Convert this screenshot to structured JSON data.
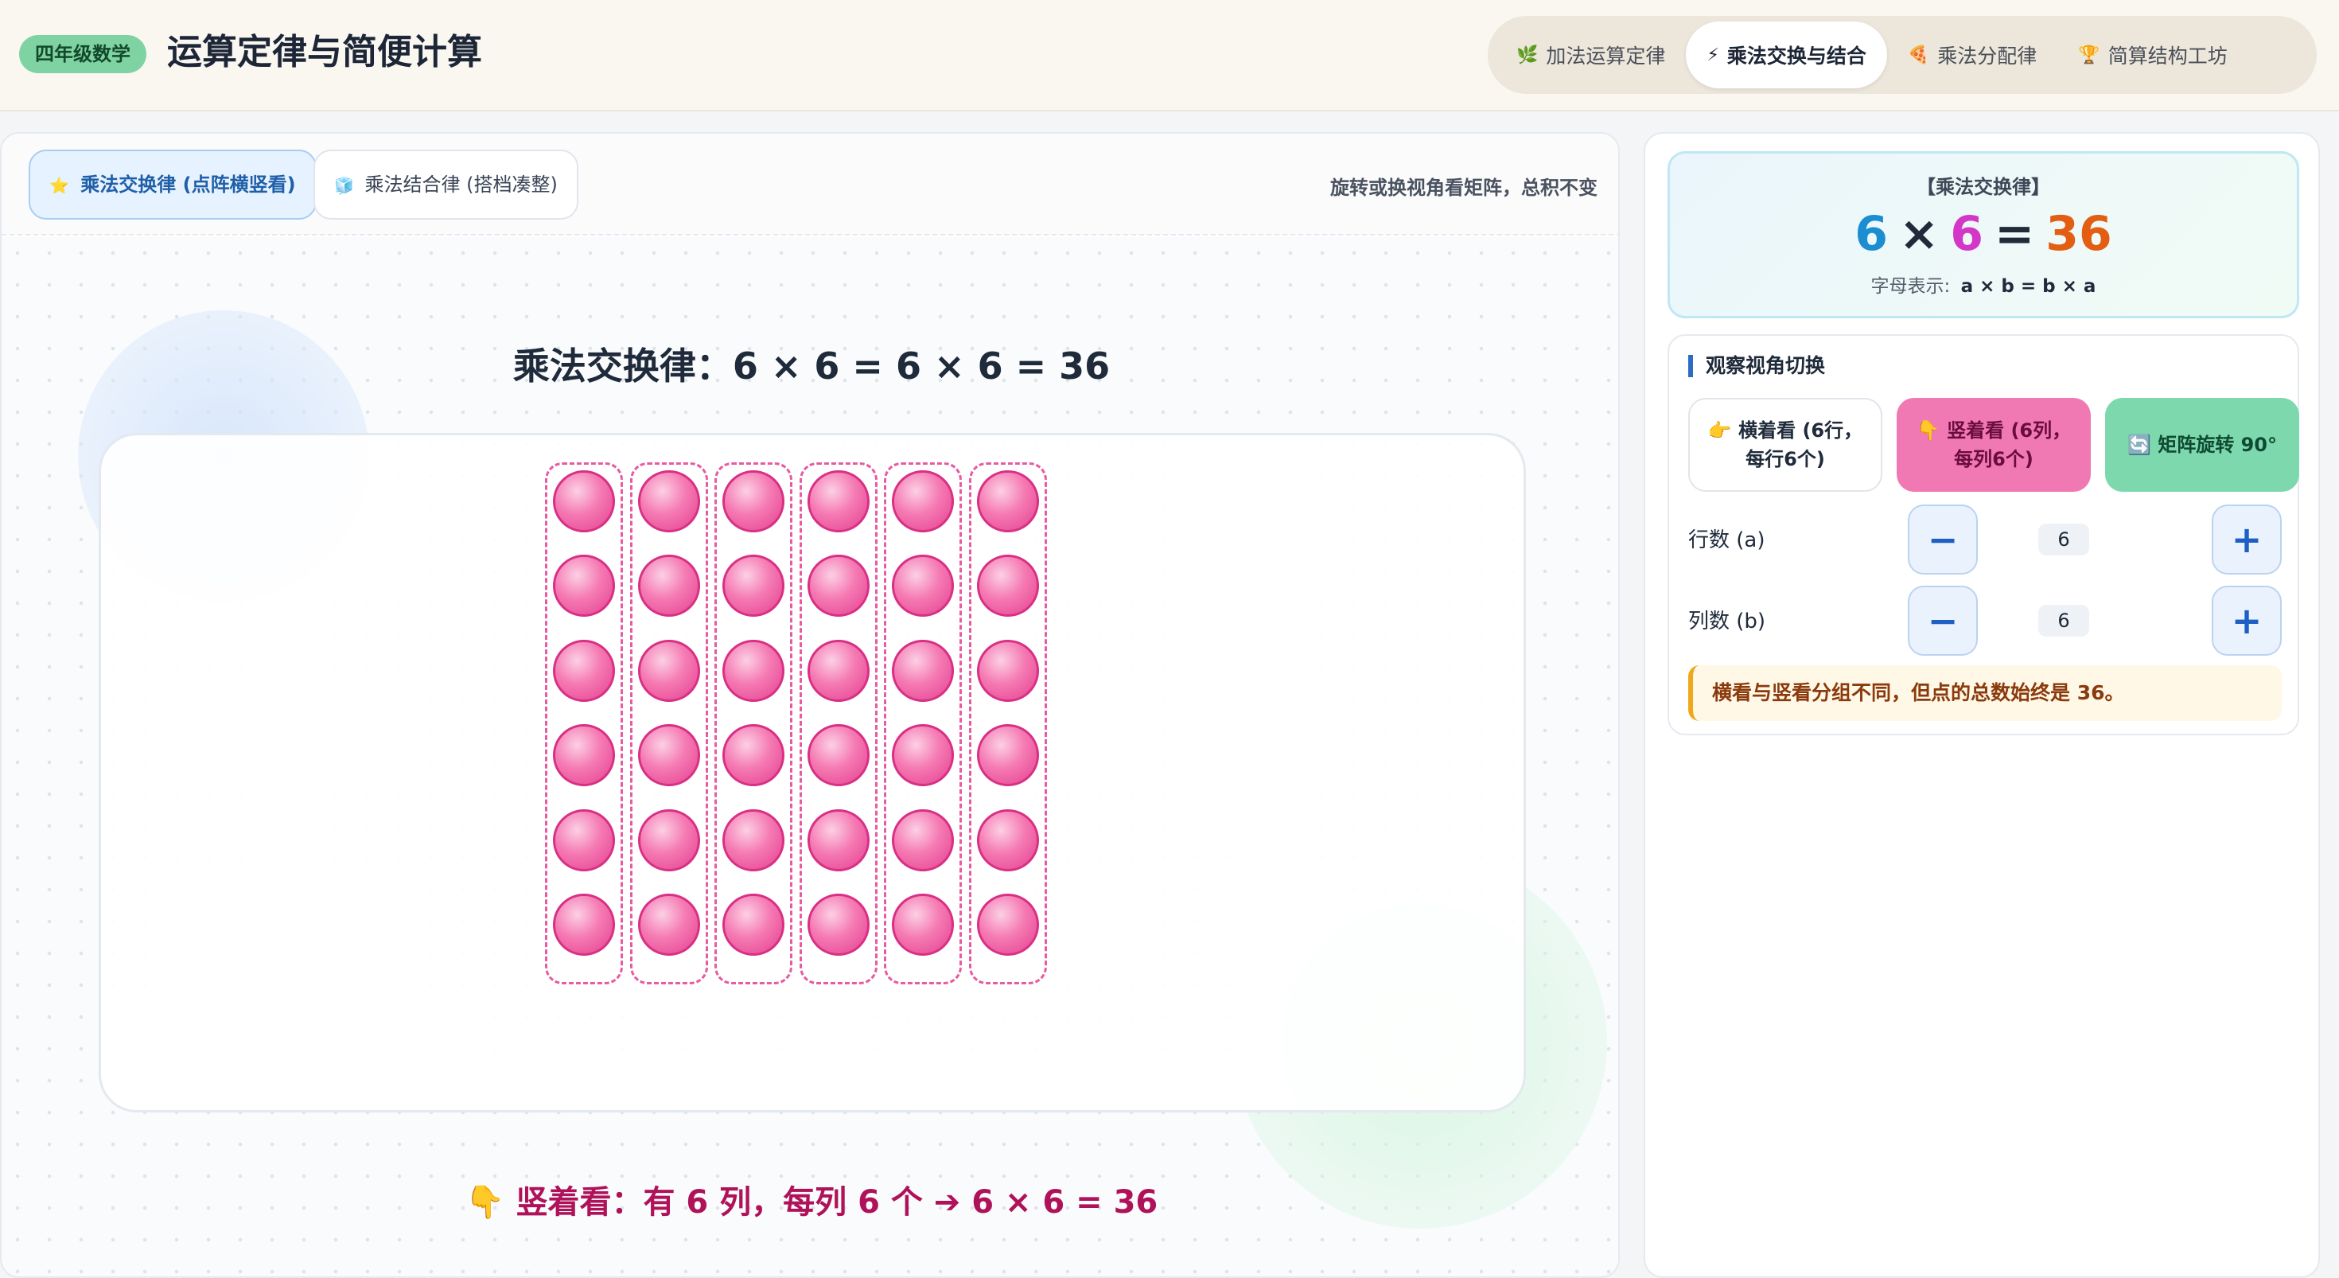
{
  "header": {
    "badge": "四年级数学",
    "title": "运算定律与简便计算",
    "tabs": [
      {
        "icon": "🌿",
        "label": "加法运算定律",
        "active": false
      },
      {
        "icon": "⚡",
        "label": "乘法交换与结合",
        "active": true
      },
      {
        "icon": "🍕",
        "label": "乘法分配律",
        "active": false
      },
      {
        "icon": "🏆",
        "label": "简算结构工坊",
        "active": false
      }
    ]
  },
  "main": {
    "subtabs": [
      {
        "icon": "⭐",
        "label": "乘法交换律 (点阵横竖看)",
        "active": true
      },
      {
        "icon": "🧊",
        "label": "乘法结合律 (搭档凑整)",
        "active": false
      }
    ],
    "hint": "旋转或换视角看矩阵，总积不变",
    "law_title": "乘法交换律：6 × 6 = 6 × 6 = 36",
    "grid": {
      "rows": 6,
      "cols": 6,
      "view": "vertical"
    },
    "caption": "👇 竖着看：有 6 列，每列 6 个 ➔ 6 × 6 = 36"
  },
  "side": {
    "formula": {
      "label": "【乘法交换律】",
      "a": "6",
      "op": "×",
      "b": "6",
      "eq": "=",
      "result": "36",
      "letter_label": "字母表示:",
      "letter_expr": "a × b = b × a"
    },
    "view": {
      "title": "观察视角切换",
      "btn_horizontal": "👉 横着看 (6行，每行6个)",
      "btn_vertical": "👇 竖着看 (6列，每列6个)",
      "btn_rotate": "🔄 矩阵旋转 90°",
      "rows_label": "行数 (a)",
      "rows_value": "6",
      "cols_label": "列数 (b)",
      "cols_value": "6",
      "minus": "−",
      "plus": "+",
      "note": "横看与竖看分组不同，但点的总数始终是 36。"
    }
  },
  "colors": {
    "accent": "#2e6bc4",
    "dot": "#f57ab3",
    "vertical_btn": "#f079b3",
    "rotate_btn": "#7dd8ae",
    "badge": "#7fd3a2"
  }
}
